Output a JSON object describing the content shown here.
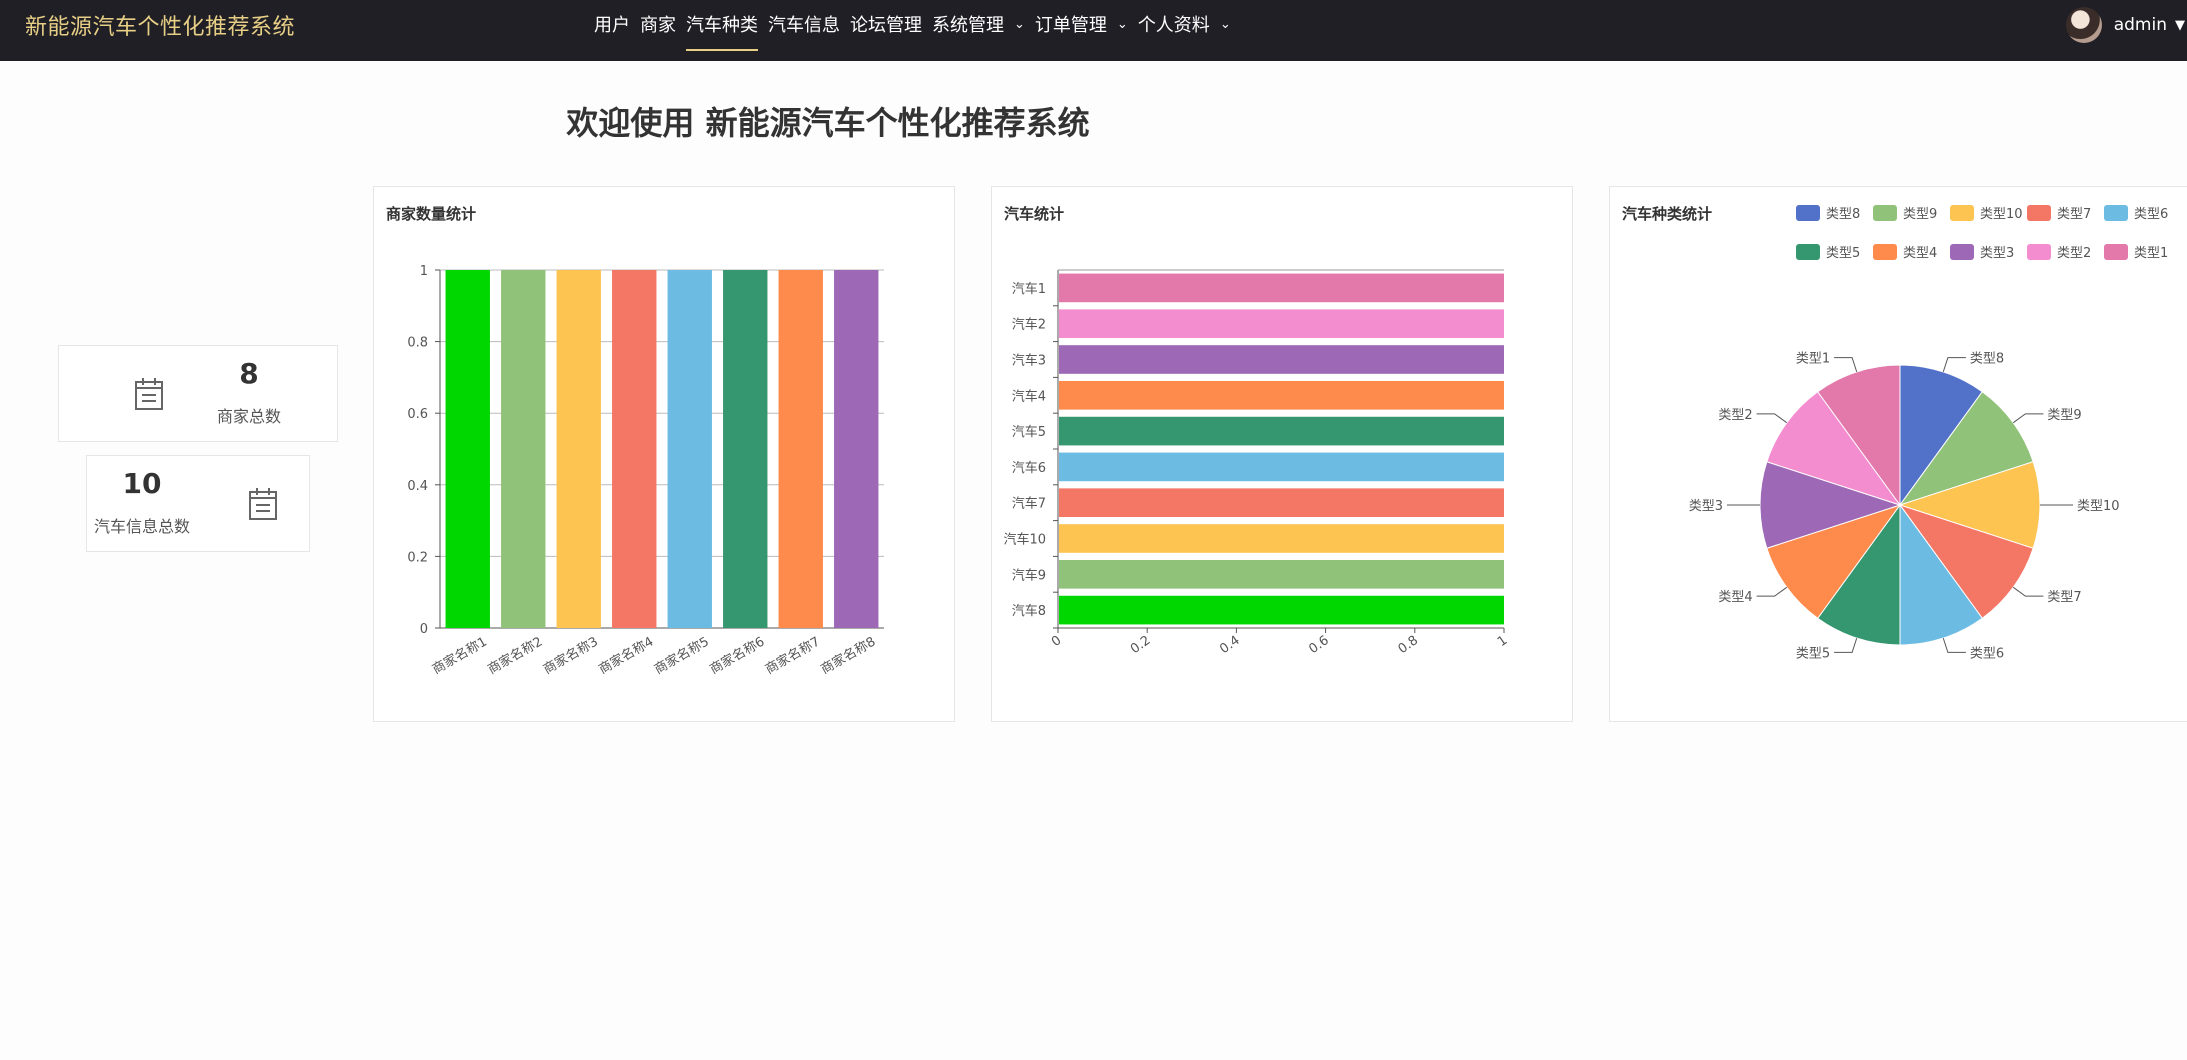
{
  "header": {
    "brand": "新能源汽车个性化推荐系统",
    "nav": [
      {
        "label": "用户",
        "dropdown": false,
        "active": false
      },
      {
        "label": "商家",
        "dropdown": false,
        "active": false
      },
      {
        "label": "汽车种类",
        "dropdown": false,
        "active": true
      },
      {
        "label": "汽车信息",
        "dropdown": false,
        "active": false
      },
      {
        "label": "论坛管理",
        "dropdown": false,
        "active": false
      },
      {
        "label": "系统管理",
        "dropdown": true,
        "active": false
      },
      {
        "label": "订单管理",
        "dropdown": true,
        "active": false
      },
      {
        "label": "个人资料",
        "dropdown": true,
        "active": false
      }
    ],
    "username": "admin"
  },
  "welcome": "欢迎使用 新能源汽车个性化推荐系统",
  "stats": {
    "merchant": {
      "value": "8",
      "label": "商家总数",
      "icon": "calendar-icon"
    },
    "car": {
      "value": "10",
      "label": "汽车信息总数",
      "icon": "calendar-icon"
    }
  },
  "chart_data": [
    {
      "type": "bar",
      "title": "商家数量统计",
      "categories": [
        "商家名称1",
        "商家名称2",
        "商家名称3",
        "商家名称4",
        "商家名称5",
        "商家名称6",
        "商家名称7",
        "商家名称8"
      ],
      "values": [
        1,
        1,
        1,
        1,
        1,
        1,
        1,
        1
      ],
      "colors": [
        "#00d700",
        "#91c27a",
        "#fdc452",
        "#f47664",
        "#6cbbe3",
        "#34976f",
        "#fe8a4b",
        "#9d69b7"
      ],
      "ylim": [
        0,
        1
      ],
      "yticks": [
        0,
        0.2,
        0.4,
        0.6,
        0.8,
        1
      ],
      "grid": true
    },
    {
      "type": "bar",
      "orientation": "horizontal",
      "title": "汽车统计",
      "categories": [
        "汽车1",
        "汽车2",
        "汽车3",
        "汽车4",
        "汽车5",
        "汽车6",
        "汽车7",
        "汽车10",
        "汽车9",
        "汽车8"
      ],
      "values": [
        1,
        1,
        1,
        1,
        1,
        1,
        1,
        1,
        1,
        1
      ],
      "colors": [
        "#e378ab",
        "#f38dd0",
        "#9d69b7",
        "#fe8a4b",
        "#34976f",
        "#6cbbe3",
        "#f47664",
        "#fdc452",
        "#91c27a",
        "#00d700"
      ],
      "xlim": [
        0,
        1
      ],
      "xticks": [
        0,
        0.2,
        0.4,
        0.6,
        0.8,
        1
      ]
    },
    {
      "type": "pie",
      "title": "汽车种类统计",
      "labels": [
        "类型8",
        "类型9",
        "类型10",
        "类型7",
        "类型6",
        "类型5",
        "类型4",
        "类型3",
        "类型2",
        "类型1"
      ],
      "values": [
        1,
        1,
        1,
        1,
        1,
        1,
        1,
        1,
        1,
        1
      ],
      "colors": [
        "#5271c9",
        "#91c27a",
        "#fdc452",
        "#f47664",
        "#6cbbe3",
        "#34976f",
        "#fe8a4b",
        "#9d69b7",
        "#f38dd0",
        "#e378ab"
      ],
      "legend": "top-right"
    }
  ]
}
